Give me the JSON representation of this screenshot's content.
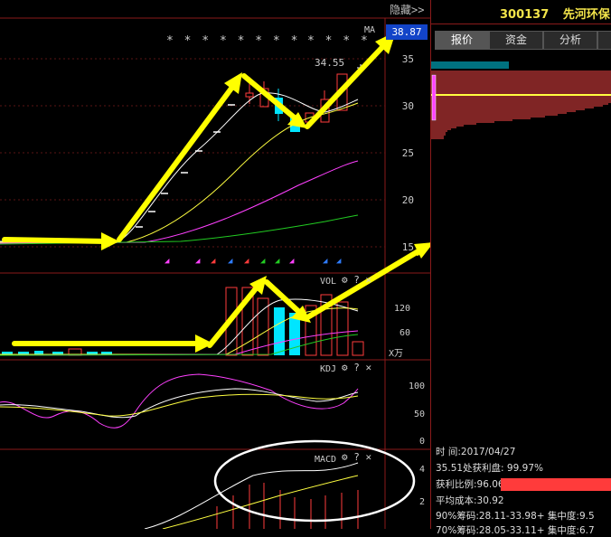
{
  "header": {
    "hide_label": "隐藏>>",
    "stock_code": "300137",
    "stock_name": "先河环保"
  },
  "tabs": [
    {
      "label": "报价",
      "active": true
    },
    {
      "label": "资金",
      "active": false
    },
    {
      "label": "分析",
      "active": false
    },
    {
      "label": "",
      "active": false
    }
  ],
  "main_chart": {
    "indicator": "MA",
    "current_price": "38.87",
    "high_marker": "34.55",
    "stars_left": "* * * * * * * *",
    "stars_right": "* * * *",
    "y_ticks": [
      "35",
      "30",
      "25",
      "20",
      "15"
    ]
  },
  "vol_panel": {
    "label": "VOL",
    "y_ticks": [
      "120",
      "60"
    ],
    "unit": "X万"
  },
  "kdj_panel": {
    "label": "KDJ",
    "y_ticks": [
      "100",
      "50",
      "0"
    ]
  },
  "macd_panel": {
    "label": "MACD",
    "y_ticks": [
      "4",
      "2"
    ]
  },
  "panel_icons": {
    "settings": "⚙",
    "help": "?",
    "close": "✕"
  },
  "chip_info": {
    "time_label": "时         间:",
    "time_value": "2017/04/27",
    "profit_at": "35.51处获利盘: 99.97%",
    "profit_ratio_label": "获利比例:",
    "profit_ratio_value": "96.06%",
    "avg_cost": "平均成本:30.92",
    "chip90": "90%筹码:28.11-33.98+ 集中度:9.5",
    "chip70": "70%筹码:28.05-33.11+ 集中度:6.7"
  },
  "colors": {
    "up": "#ff3b3b",
    "down": "#00e5ff",
    "arrow": "#ffff00",
    "accent_blue": "#1244c8"
  }
}
